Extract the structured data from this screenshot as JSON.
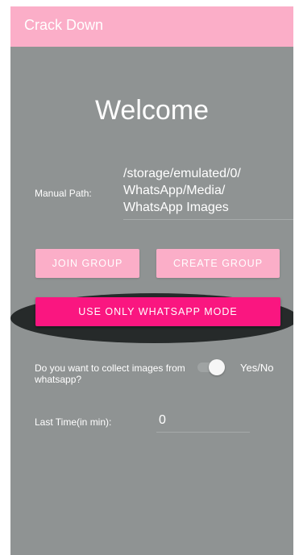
{
  "app_bar": {
    "title": "Crack Down"
  },
  "main": {
    "welcome": "Welcome",
    "manual_path": {
      "label": "Manual Path:",
      "value": "/storage/emulated/0/\nWhatsApp/Media/\nWhatsApp Images"
    },
    "buttons": {
      "join_group": "JOIN GROUP",
      "create_group": "CREATE GROUP",
      "whatsapp_mode": "USE ONLY WHATSAPP MODE"
    },
    "collect": {
      "label": "Do you want to collect images from whatsapp?",
      "toggle_state": "on",
      "toggle_text": "Yes/No"
    },
    "last_time": {
      "label": "Last Time(in min):",
      "value": "0"
    }
  },
  "colors": {
    "app_bar": "#fbaec8",
    "background": "#8f9393",
    "primary_button": "#fbaec8",
    "accent_button": "#fa1680",
    "highlight_oval": "#262a2a"
  }
}
